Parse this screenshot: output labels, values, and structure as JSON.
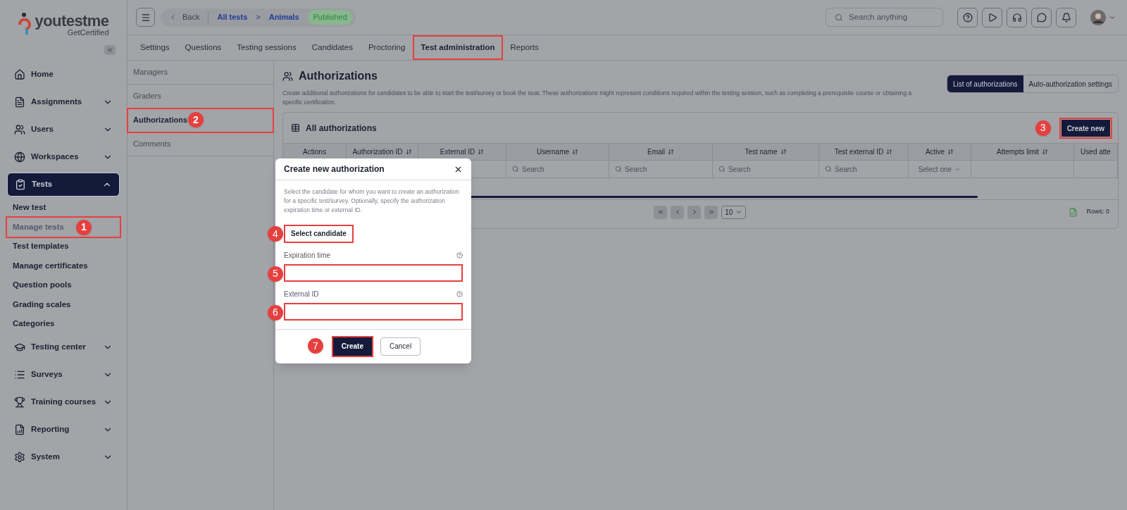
{
  "logo": {
    "name": "youtestme",
    "tagline": "GetCertified"
  },
  "sidebar": {
    "items": [
      {
        "label": "Home",
        "expandable": false,
        "selected": false
      },
      {
        "label": "Assignments",
        "expandable": true,
        "expanded": false,
        "selected": false
      },
      {
        "label": "Users",
        "expandable": true,
        "expanded": false,
        "selected": false
      },
      {
        "label": "Workspaces",
        "expandable": true,
        "expanded": false,
        "selected": false
      },
      {
        "label": "Tests",
        "expandable": true,
        "expanded": true,
        "selected": true,
        "children": [
          {
            "label": "New test",
            "selected": false
          },
          {
            "label": "Manage tests",
            "selected": true,
            "step": "1"
          },
          {
            "label": "Test templates",
            "selected": false
          },
          {
            "label": "Manage certificates",
            "selected": false
          },
          {
            "label": "Question pools",
            "selected": false
          },
          {
            "label": "Grading scales",
            "selected": false
          },
          {
            "label": "Categories",
            "selected": false
          }
        ]
      },
      {
        "label": "Testing center",
        "expandable": true,
        "expanded": false,
        "selected": false
      },
      {
        "label": "Surveys",
        "expandable": true,
        "expanded": false,
        "selected": false
      },
      {
        "label": "Training courses",
        "expandable": true,
        "expanded": false,
        "selected": false
      },
      {
        "label": "Reporting",
        "expandable": true,
        "expanded": false,
        "selected": false
      },
      {
        "label": "System",
        "expandable": true,
        "expanded": false,
        "selected": false
      }
    ]
  },
  "breadcrumb": {
    "back": "Back",
    "items": [
      "All tests",
      "Animals"
    ],
    "separator": ">",
    "status": "Published"
  },
  "search": {
    "placeholder": "Search anything"
  },
  "tabs": [
    {
      "label": "Settings",
      "selected": false
    },
    {
      "label": "Questions",
      "selected": false
    },
    {
      "label": "Testing sessions",
      "selected": false
    },
    {
      "label": "Candidates",
      "selected": false
    },
    {
      "label": "Proctoring",
      "selected": false
    },
    {
      "label": "Test administration",
      "selected": true
    },
    {
      "label": "Reports",
      "selected": false
    }
  ],
  "subnav": [
    {
      "label": "Managers",
      "selected": false
    },
    {
      "label": "Graders",
      "selected": false
    },
    {
      "label": "Authorizations",
      "selected": true,
      "step": "2"
    },
    {
      "label": "Comments",
      "selected": false
    }
  ],
  "page": {
    "title": "Authorizations",
    "description": "Create additional authorizations for candidates to be able to start the test/survey or book the seat. These authorizations might represent conditions required within the testing session, such as completing a prerequisite course or obtaining a specific certification.",
    "views": [
      {
        "label": "List of authorizations",
        "selected": true
      },
      {
        "label": "Auto-authorization settings",
        "selected": false
      }
    ]
  },
  "table": {
    "title": "All authorizations",
    "create_button": {
      "label": "Create new",
      "step": "3"
    },
    "columns": [
      {
        "label": "Actions",
        "sortable": false,
        "kind": "none"
      },
      {
        "label": "Authorization ID",
        "sortable": true,
        "kind": "none"
      },
      {
        "label": "External ID",
        "sortable": true,
        "kind": "none"
      },
      {
        "label": "Username",
        "sortable": true,
        "kind": "search",
        "filter": "Search"
      },
      {
        "label": "Email",
        "sortable": true,
        "kind": "search",
        "filter": "Search"
      },
      {
        "label": "Test name",
        "sortable": true,
        "kind": "search",
        "filter": "Search"
      },
      {
        "label": "Test external ID",
        "sortable": true,
        "kind": "search",
        "filter": "Search"
      },
      {
        "label": "Active",
        "sortable": true,
        "kind": "select",
        "filter": "Select one"
      },
      {
        "label": "Attempts limit",
        "sortable": true,
        "kind": "none"
      },
      {
        "label": "Used atte",
        "sortable": false,
        "kind": "none"
      }
    ],
    "page_size": "10",
    "rows_count": "Rows: 0"
  },
  "dialog": {
    "title": "Create new authorization",
    "description": "Select the candidate for whom you want to create an authorization for a specific test/survey. Optionally, specify the authorization expiration time or external ID.",
    "select_button": {
      "label": "Select candidate",
      "step": "4"
    },
    "fields": [
      {
        "label": "Expiration time",
        "step": "5"
      },
      {
        "label": "External ID",
        "step": "6"
      }
    ],
    "buttons": [
      {
        "label": "Create",
        "kind": "primary",
        "step": "7"
      },
      {
        "label": "Cancel",
        "kind": "secondary"
      }
    ]
  }
}
